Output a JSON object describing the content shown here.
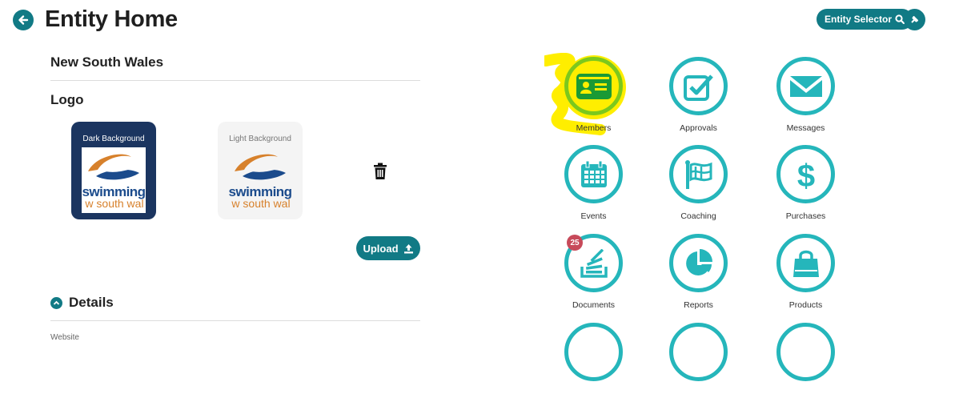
{
  "header": {
    "title": "Entity Home",
    "entity_selector_label": "Entity Selector"
  },
  "entity": {
    "name": "New South Wales"
  },
  "logo": {
    "heading": "Logo",
    "dark_label": "Dark Background",
    "light_label": "Light Background",
    "logo_text_primary": "swimming",
    "logo_text_secondary": "w south wal",
    "upload_label": "Upload"
  },
  "details": {
    "heading": "Details",
    "website_label": "Website"
  },
  "tiles": [
    {
      "label": "Members",
      "icon": "id-card-icon"
    },
    {
      "label": "Approvals",
      "icon": "checkbox-icon"
    },
    {
      "label": "Messages",
      "icon": "envelope-icon"
    },
    {
      "label": "Events",
      "icon": "calendar-icon"
    },
    {
      "label": "Coaching",
      "icon": "flag-icon"
    },
    {
      "label": "Purchases",
      "icon": "dollar-icon"
    },
    {
      "label": "Documents",
      "icon": "document-stack-icon",
      "badge": "25"
    },
    {
      "label": "Reports",
      "icon": "pie-chart-icon"
    },
    {
      "label": "Products",
      "icon": "shopping-bag-icon"
    }
  ],
  "colors": {
    "primary": "#117a85",
    "tile_ring": "#25b6bb",
    "highlight": "#ffee00",
    "badge": "#c74a5a",
    "logo_dark_bg": "#1b3560"
  }
}
